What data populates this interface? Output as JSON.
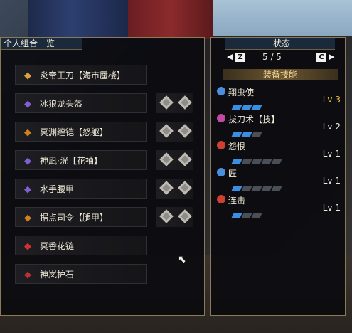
{
  "left_panel": {
    "title": "个人组合一览",
    "items": [
      {
        "name": "炎帝王刀【海市蜃楼】",
        "icon": "weapon-icon",
        "color": "#e0a040",
        "slots": 0
      },
      {
        "name": "冰狼龙头盔",
        "icon": "helmet-icon",
        "color": "#8060d0",
        "slots": 2
      },
      {
        "name": "冥渊缠铠【怒躯】",
        "icon": "chest-icon",
        "color": "#d08020",
        "slots": 2
      },
      {
        "name": "神凪·洸【花袖】",
        "icon": "arms-icon",
        "color": "#8060d0",
        "slots": 2
      },
      {
        "name": "水手腰甲",
        "icon": "waist-icon",
        "color": "#8060d0",
        "slots": 2
      },
      {
        "name": "据点司令【腿甲】",
        "icon": "legs-icon",
        "color": "#d08020",
        "slots": 2
      },
      {
        "name": "冥香花链",
        "icon": "charm-chain-icon",
        "color": "#d03030",
        "slots": 0
      },
      {
        "name": "神岚护石",
        "icon": "talisman-icon",
        "color": "#c03030",
        "slots": 0
      }
    ]
  },
  "right_panel": {
    "title": "状态",
    "nav": {
      "left_key": "Z",
      "page": "5 / 5",
      "right_key": "C"
    },
    "section_title": "装备技能",
    "skills": [
      {
        "name": "翔虫使",
        "icon_color": "#4a8ee0",
        "filled": 3,
        "total": 3,
        "level": "Lv 3",
        "max": true
      },
      {
        "name": "拔刀术【技】",
        "icon_color": "#c04aa0",
        "filled": 2,
        "total": 3,
        "level": "Lv 2",
        "max": false
      },
      {
        "name": "怨恨",
        "icon_color": "#d04030",
        "filled": 1,
        "total": 5,
        "level": "Lv 1",
        "max": false
      },
      {
        "name": "匠",
        "icon_color": "#4a8ee0",
        "filled": 1,
        "total": 5,
        "level": "Lv 1",
        "max": false
      },
      {
        "name": "连击",
        "icon_color": "#d04030",
        "filled": 1,
        "total": 3,
        "level": "Lv 1",
        "max": false
      }
    ]
  }
}
